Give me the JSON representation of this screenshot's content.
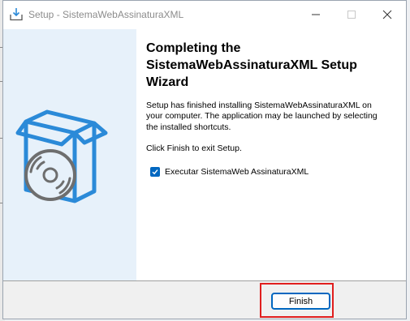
{
  "window": {
    "title": "Setup - SistemaWebAssinaturaXML"
  },
  "content": {
    "heading_lines": [
      "Completing the",
      "SistemaWebAssinaturaXML Setup",
      "Wizard"
    ],
    "description_lines": [
      "Setup has finished installing SistemaWebAssinaturaXML on",
      "your computer. The application may be launched by selecting",
      "the installed shortcuts."
    ],
    "finish_note": "Click Finish to exit Setup.",
    "checkbox": {
      "label": "Executar SistemaWeb AssinaturaXML",
      "checked": true
    }
  },
  "footer": {
    "finish_label": "Finish"
  },
  "colors": {
    "accent": "#0067c0",
    "side_panel": "#e7f1fa",
    "installer_icon": "#2b8ad8",
    "highlight": "#e01e1e"
  },
  "icons": {
    "title": "installer-download-icon",
    "side": "box-with-disc-icon"
  }
}
